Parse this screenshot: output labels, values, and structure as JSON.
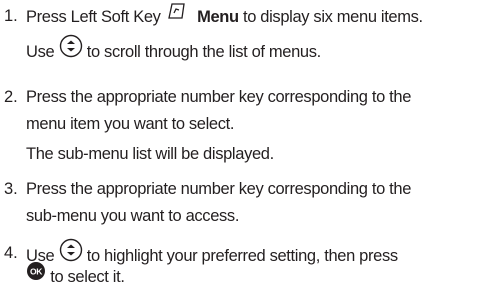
{
  "steps": [
    {
      "number": "1.",
      "line1_a": "Press Left Soft Key",
      "line1_bold": "Menu",
      "line1_b": "to display six menu items.",
      "sub_a": "Use",
      "sub_b": "to scroll through the list of menus."
    },
    {
      "number": "2.",
      "line1": "Press the appropriate number key corresponding to the",
      "line2": "menu item you want to select.",
      "sub": "The sub-menu list will be displayed."
    },
    {
      "number": "3.",
      "line1": "Press the appropriate number key corresponding to the",
      "line2": "sub-menu you want to access."
    },
    {
      "number": "4.",
      "line1_a": "Use",
      "line1_b": "to highlight your preferred setting, then press",
      "line2_b": "to select it."
    }
  ],
  "icons": {
    "soft_key": "left-soft-key-icon",
    "nav": "navigation-key-icon",
    "ok": "ok-key-icon",
    "ok_label": "OK"
  }
}
